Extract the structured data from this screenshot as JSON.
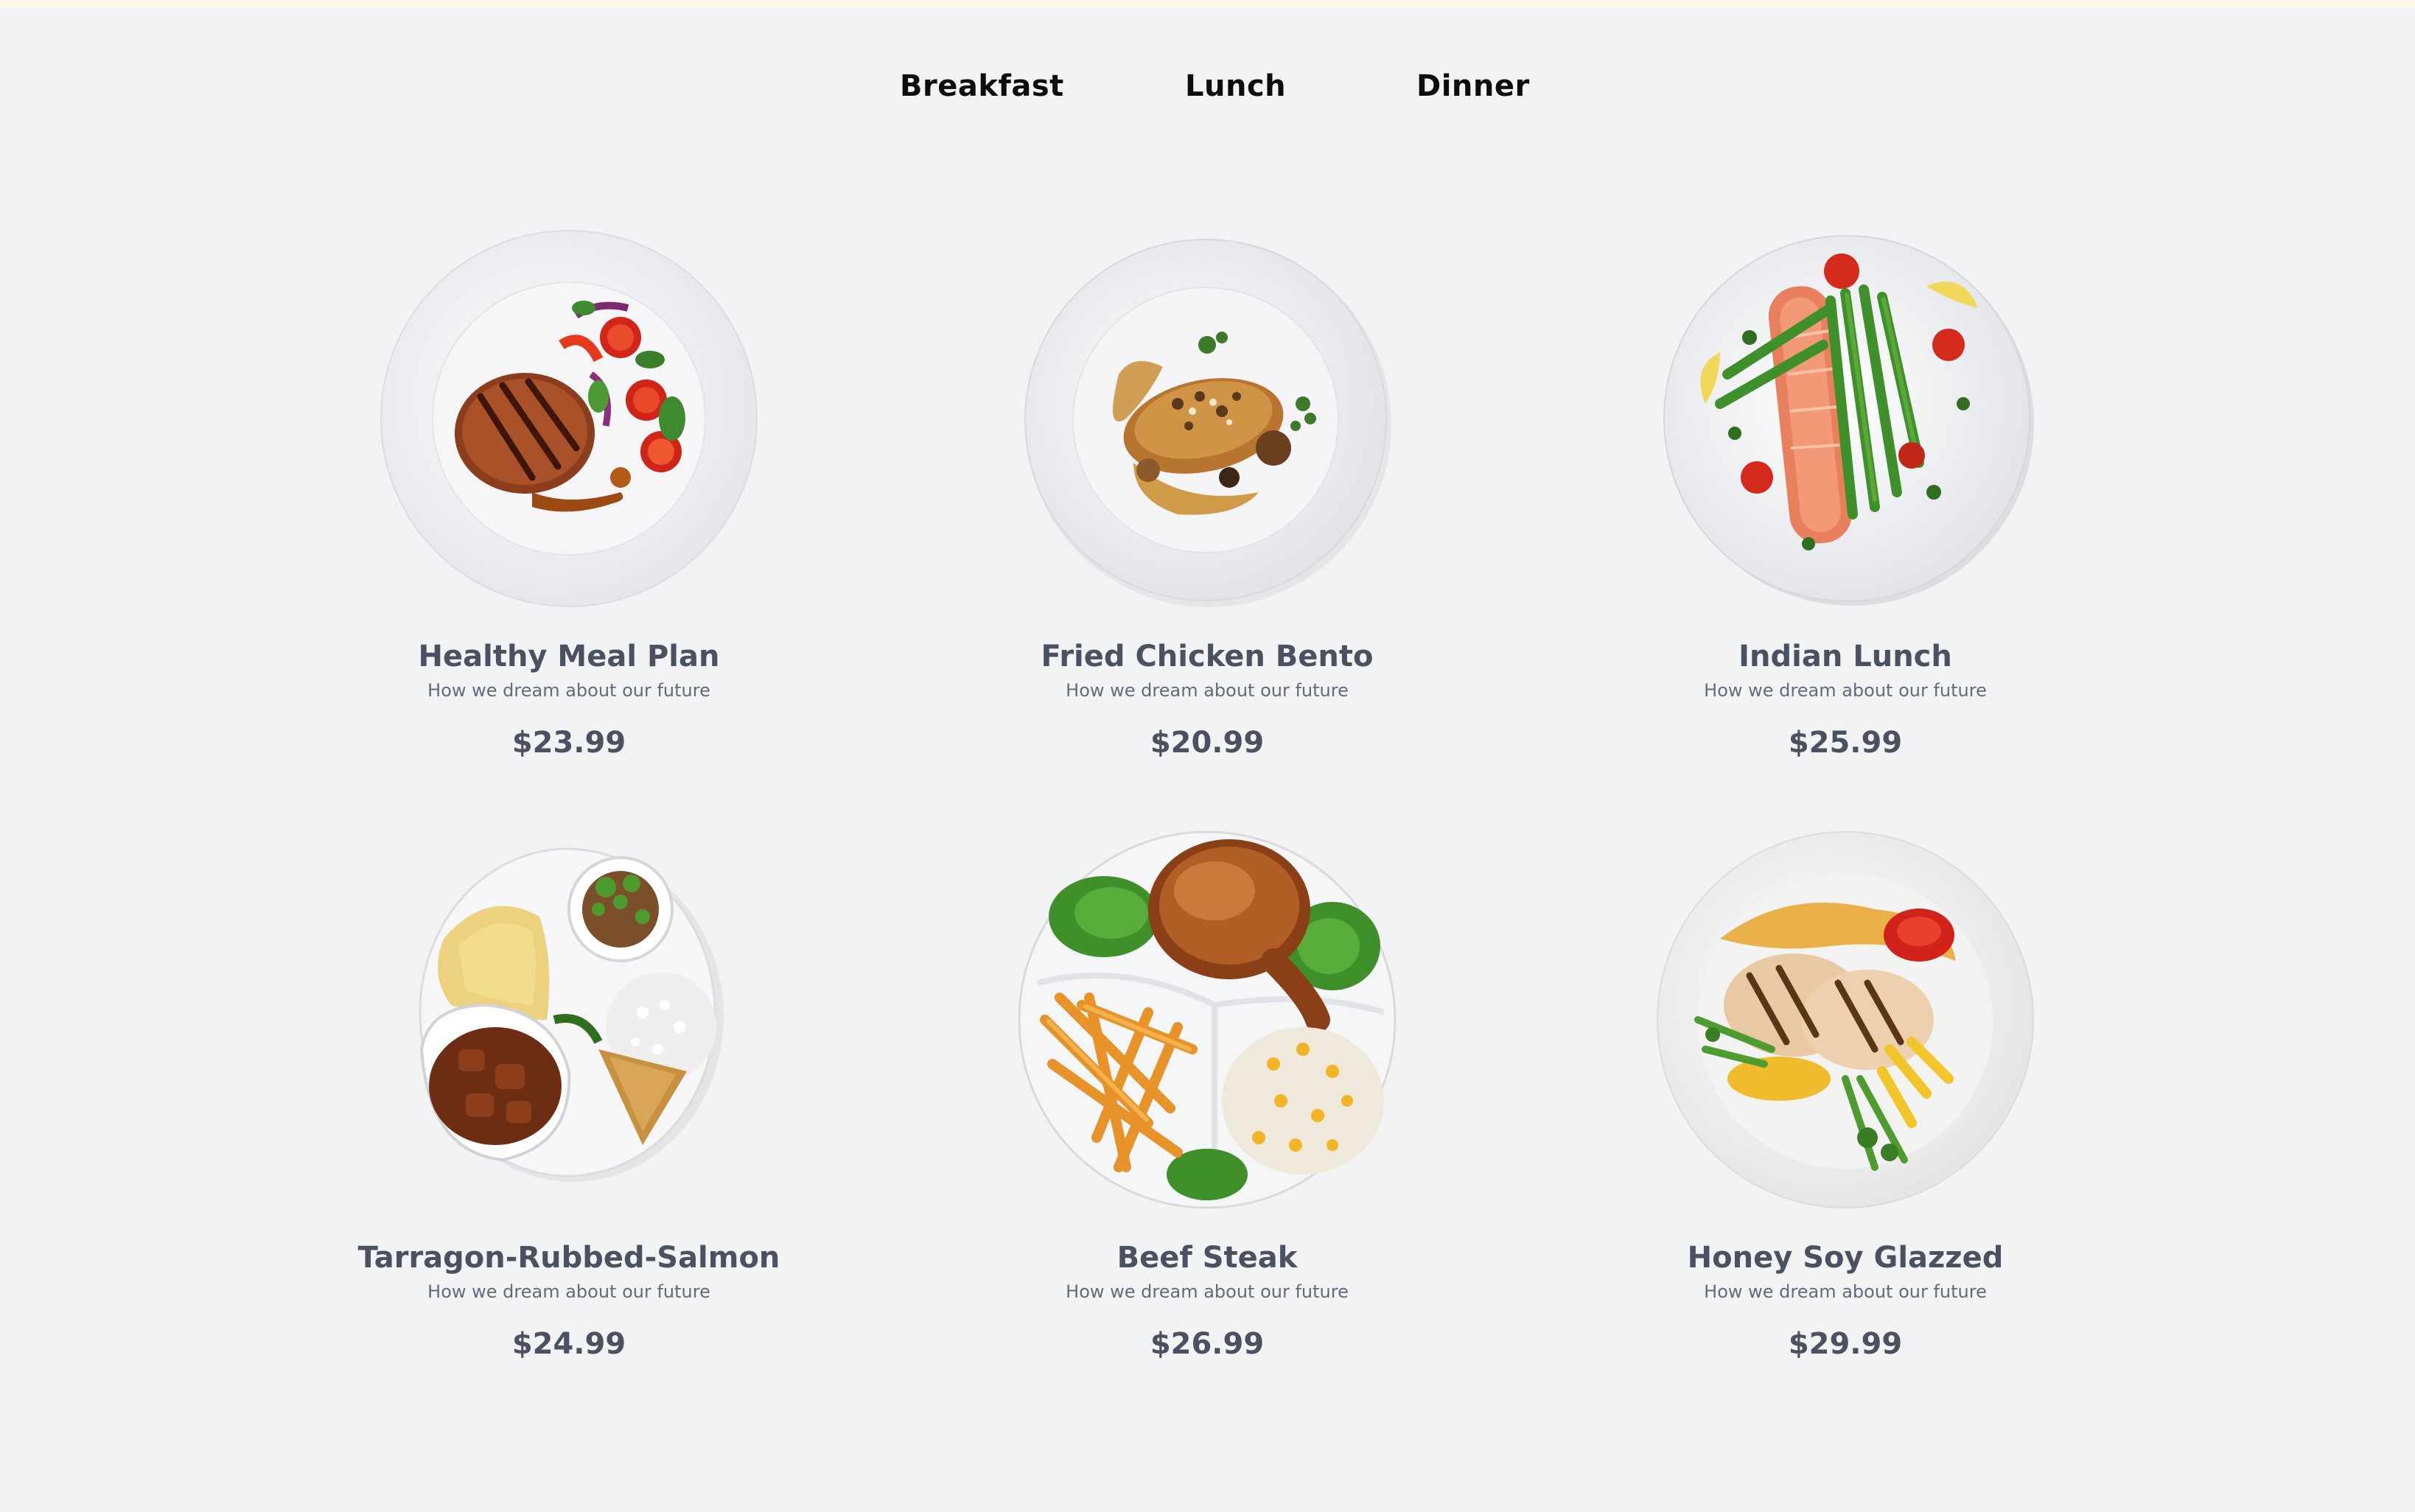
{
  "tabs": [
    {
      "label": "Breakfast"
    },
    {
      "label": "Lunch"
    },
    {
      "label": "Dinner"
    }
  ],
  "menu": {
    "items": [
      {
        "title": "Healthy Meal Plan",
        "subtitle": "How we dream about our future",
        "price": "$23.99",
        "image": "grilled-pork-chop-plate"
      },
      {
        "title": "Fried Chicken Bento",
        "subtitle": "How we dream about our future",
        "price": "$20.99",
        "image": "chicken-sauce-plate"
      },
      {
        "title": "Indian Lunch",
        "subtitle": "How we dream about our future",
        "price": "$25.99",
        "image": "salmon-asparagus-plate"
      },
      {
        "title": "Tarragon-Rubbed-Salmon",
        "subtitle": "How we dream about our future",
        "price": "$24.99",
        "image": "indian-thali-plate"
      },
      {
        "title": "Beef Steak",
        "subtitle": "How we dream about our future",
        "price": "$26.99",
        "image": "roast-chicken-fries-plate"
      },
      {
        "title": "Honey Soy Glazzed",
        "subtitle": "How we dream about our future",
        "price": "$29.99",
        "image": "grilled-chicken-veg-plate"
      }
    ]
  }
}
